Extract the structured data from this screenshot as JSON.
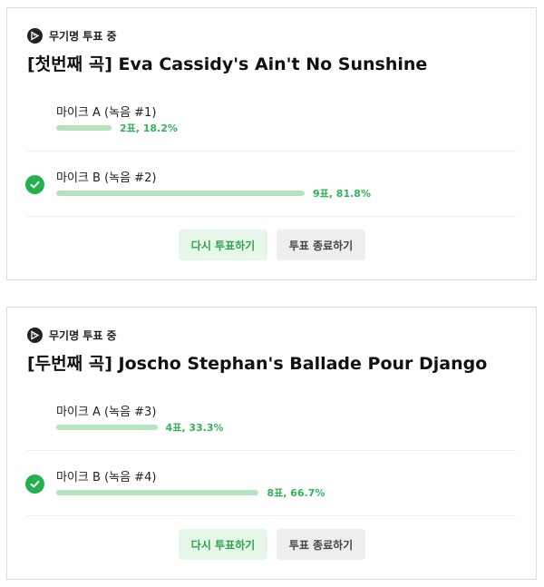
{
  "polls": [
    {
      "status": "무기명 투표 중",
      "title": "[첫번째 곡] Eva Cassidy's Ain't No Sunshine",
      "options": [
        {
          "label": "마이크 A (녹음 #1)",
          "result": "2표, 18.2%",
          "fraction": 0.182,
          "selected": false
        },
        {
          "label": "마이크 B (녹음 #2)",
          "result": "9표, 81.8%",
          "fraction": 0.818,
          "selected": true
        }
      ],
      "revote_label": "다시 투표하기",
      "end_label": "투표 종료하기"
    },
    {
      "status": "무기명 투표 중",
      "title": "[두번째 곡] Joscho Stephan's Ballade Pour Django",
      "options": [
        {
          "label": "마이크 A (녹음 #3)",
          "result": "4표, 33.3%",
          "fraction": 0.333,
          "selected": false
        },
        {
          "label": "마이크 B (녹음 #4)",
          "result": "8표, 66.7%",
          "fraction": 0.667,
          "selected": true
        }
      ],
      "revote_label": "다시 투표하기",
      "end_label": "투표 종료하기"
    }
  ],
  "colors": {
    "bar": "#b4e3bf",
    "accent": "#22b14c",
    "percent_text": "#2fb457"
  },
  "icons": {
    "status": "vote-list-icon",
    "selected": "check-circle-icon"
  }
}
